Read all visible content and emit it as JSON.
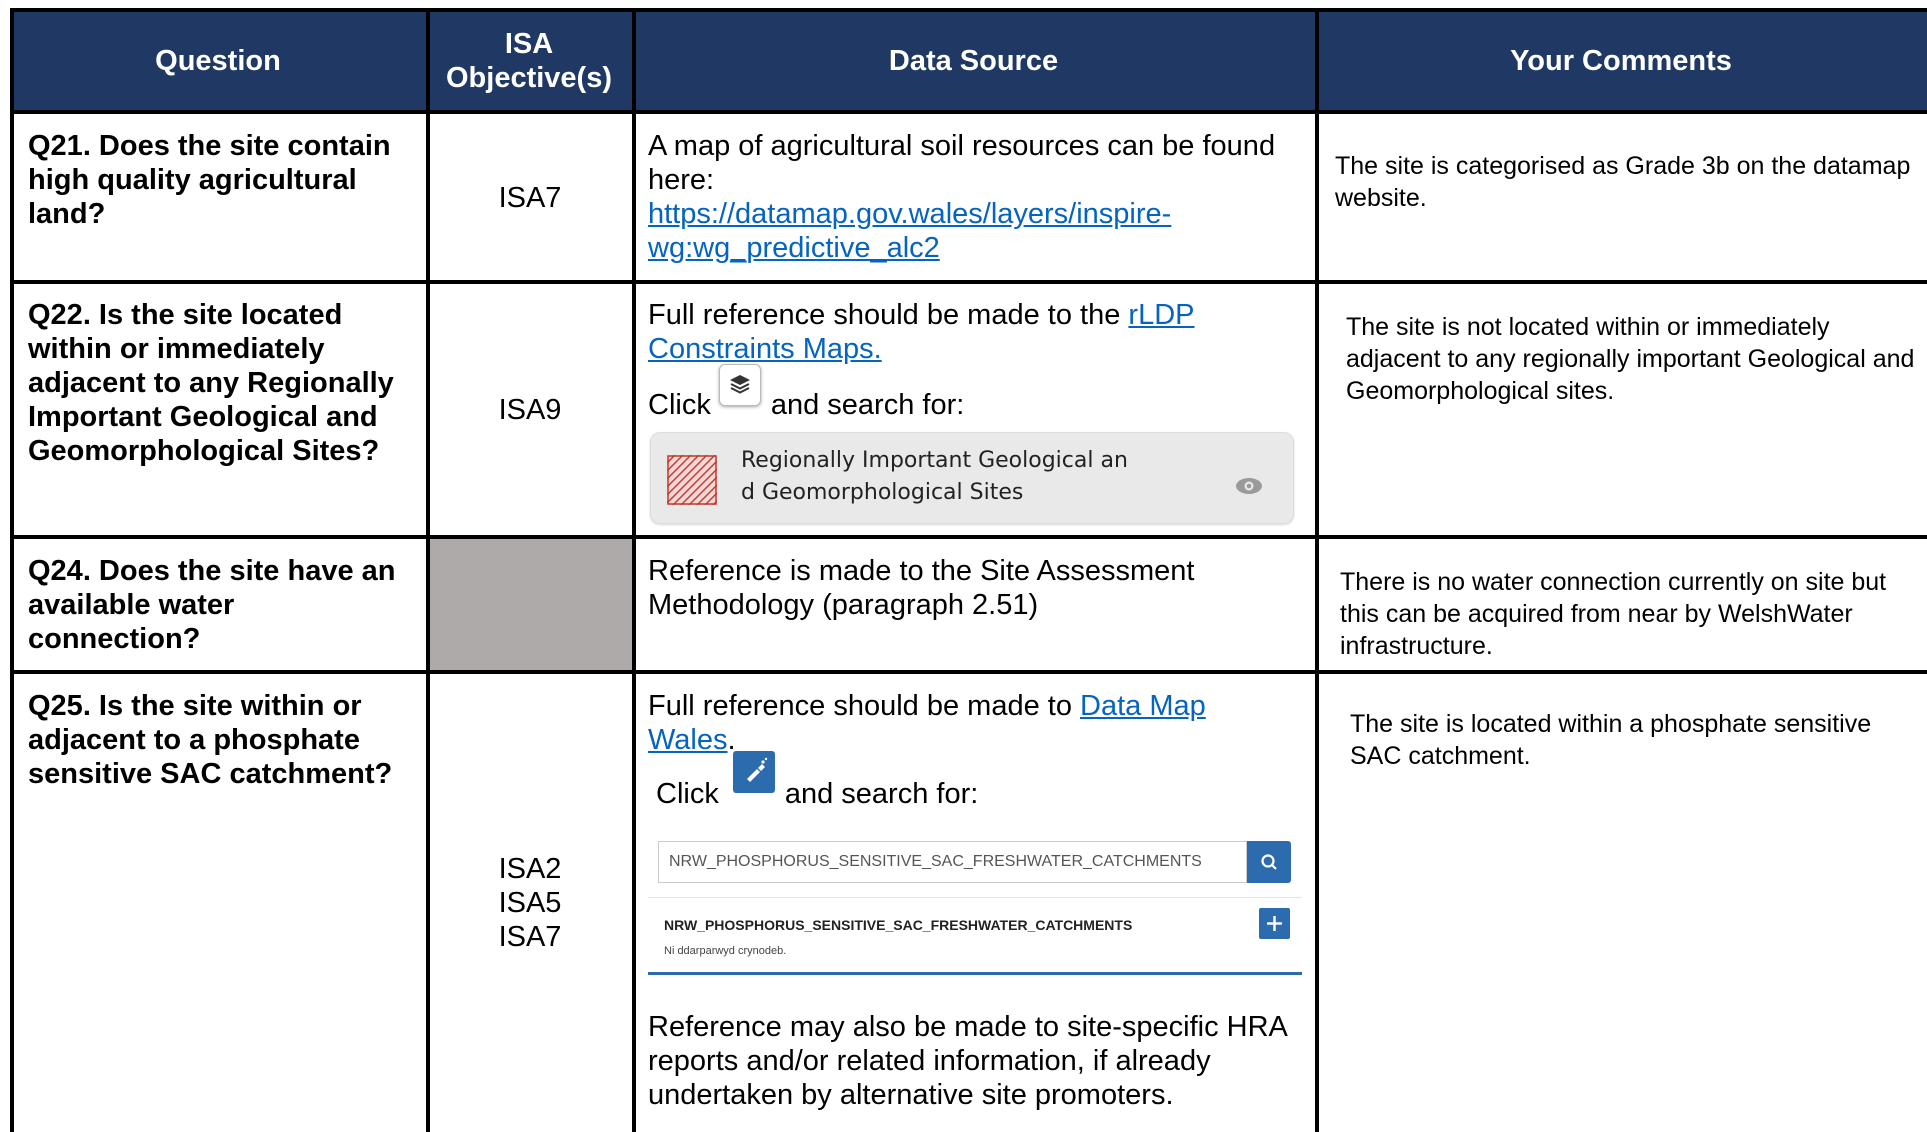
{
  "header": {
    "question": "Question",
    "isa": "ISA Objective(s)",
    "isa_line1": "ISA",
    "isa_line2": "Objective(s)",
    "source": "Data Source",
    "comments": "Your Comments"
  },
  "rows": [
    {
      "question": "Q21. Does the site contain high quality agricultural land?",
      "isa": "ISA7",
      "source_text": "A map of agricultural soil resources can be found here:",
      "source_link_1": "https://datamap.gov.wales/layers/inspire-",
      "source_link_2": "wg:wg_predictive_alc2",
      "comment": "The site is categorised as Grade 3b on the datamap website."
    },
    {
      "question": "Q22. Is the site located within or immediately adjacent to any Regionally Important Geological and Geomorphological Sites?",
      "isa": "ISA9",
      "source_pre": "Full reference should be made to the ",
      "source_link_1": "rLDP",
      "source_link_2": "Constraints Maps.",
      "click_label": "Click",
      "search_label": "and search for:",
      "layer_name_1": "Regionally Important Geological an",
      "layer_name_2": "d Geomorphological Sites",
      "comment": "The site is not located within or immediately adjacent to any regionally important Geological and Geomorphological sites."
    },
    {
      "question": "Q24. Does the site have an available water connection?",
      "isa": "",
      "source_text": "Reference is made to the Site Assessment Methodology (paragraph 2.51)",
      "comment": "There is no water connection currently on site but this can be acquired from near by WelshWater infrastructure."
    },
    {
      "question": "Q25. Is the site within or adjacent to a phosphate sensitive SAC catchment?",
      "isa_1": "ISA2",
      "isa_2": "ISA5",
      "isa_3": "ISA7",
      "source_pre": "Full reference should be made to ",
      "source_link_1": "Data Map",
      "source_link_2": "Wales",
      "source_post": ".",
      "click_label": "Click",
      "search_label": "and search for:",
      "search_value": "NRW_PHOSPHORUS_SENSITIVE_SAC_FRESHWATER_CATCHMENTS",
      "result_title": "NRW_PHOSPHORUS_SENSITIVE_SAC_FRESHWATER_CATCHMENTS",
      "result_subtitle": "Ni ddarparwyd crynodeb.",
      "source_more": "Reference may also be made to site-specific HRA reports and/or related information, if already undertaken by alternative site promoters.",
      "comment": "The site is located within a phosphate sensitive SAC catchment."
    }
  ],
  "colors": {
    "header_bg": "#1f3864",
    "link": "#0563c1",
    "grey_cell": "#aeaaaa",
    "search_btn": "#2c6bad"
  },
  "icons": [
    "layers-icon",
    "eye-icon",
    "hatched-swatch-icon",
    "paint-brush-icon",
    "search-icon",
    "plus-icon"
  ]
}
